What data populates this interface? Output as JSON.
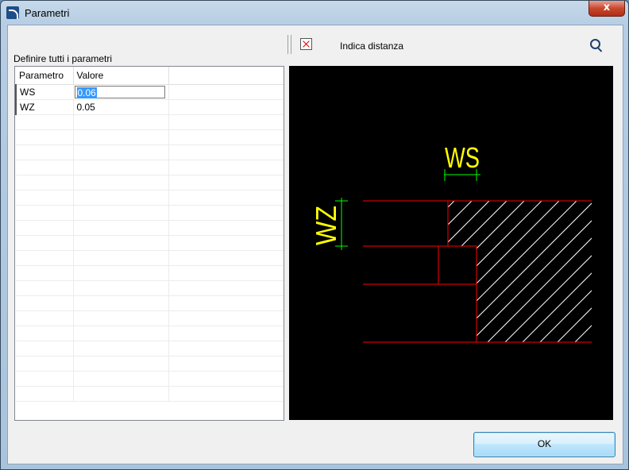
{
  "window": {
    "title": "Parametri",
    "close_glyph": "x"
  },
  "toolbar": {
    "delete_icon": "delete-rect-icon",
    "indicate_distance_label": "Indica distanza",
    "zoom_icon": "magnifier-icon"
  },
  "section_label": "Definire tutti i parametri",
  "grid": {
    "columns": [
      "Parametro",
      "Valore"
    ],
    "rows": [
      {
        "name": "WS",
        "value": "0.06"
      },
      {
        "name": "WZ",
        "value": "0.05"
      }
    ]
  },
  "preview": {
    "label_ws": "WS",
    "label_wz": "WZ",
    "colors": {
      "background": "#000000",
      "outline": "#ff0000",
      "hatch": "#ffffff",
      "dim_text": "#ffff00",
      "dim_line": "#00ff00"
    }
  },
  "buttons": {
    "ok_label": "OK"
  }
}
